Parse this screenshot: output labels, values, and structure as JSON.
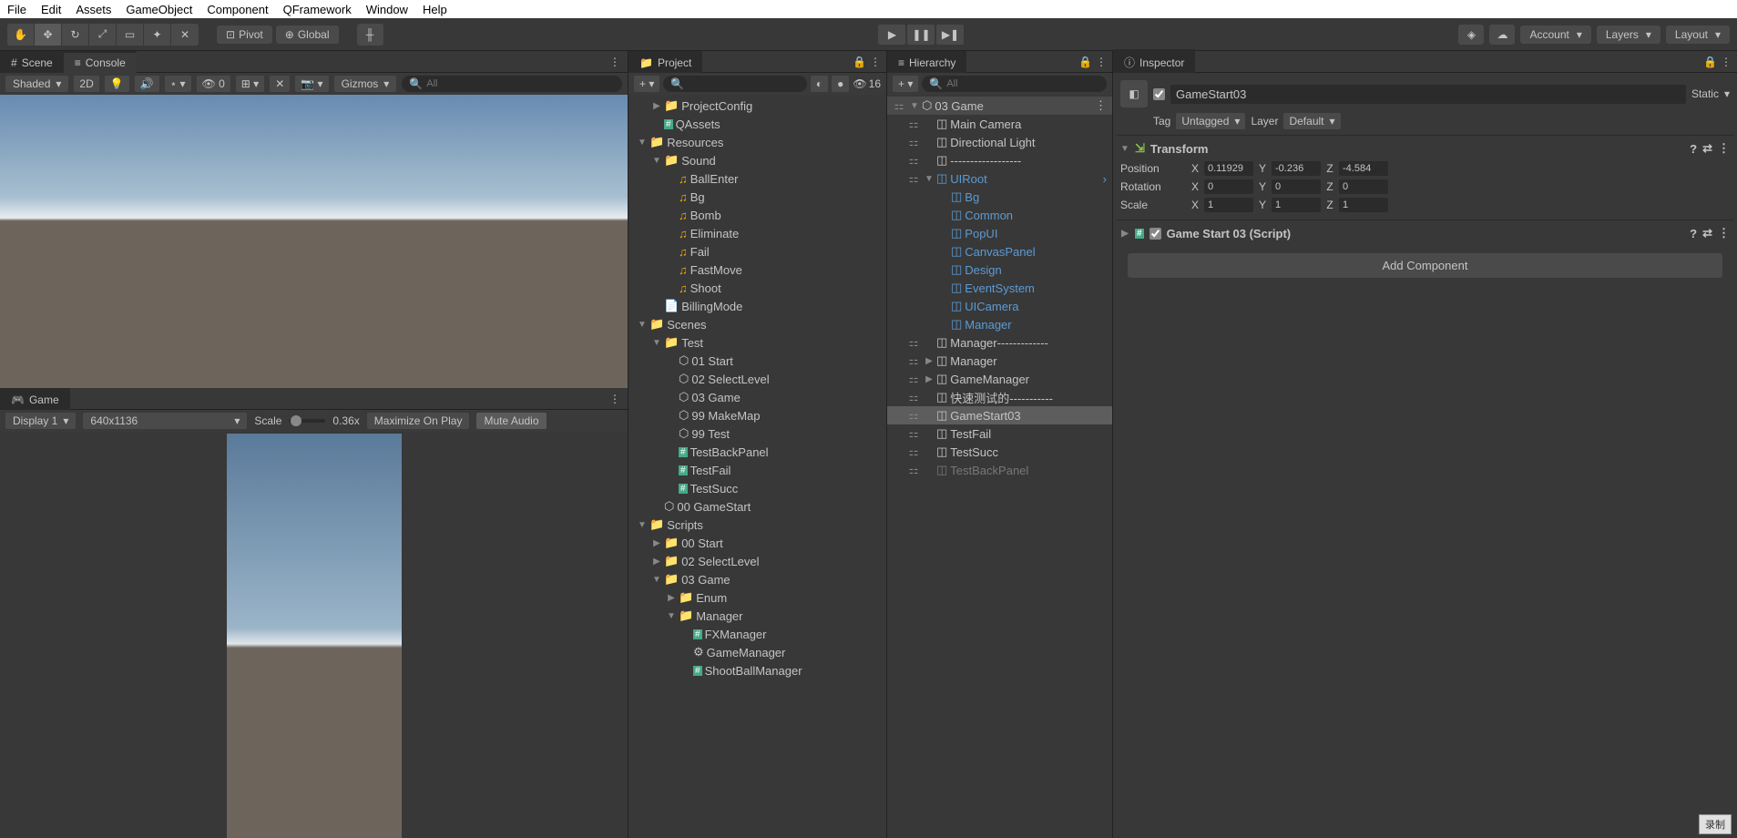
{
  "menubar": [
    "File",
    "Edit",
    "Assets",
    "GameObject",
    "Component",
    "QFramework",
    "Window",
    "Help"
  ],
  "toolbar": {
    "pivot": "Pivot",
    "global": "Global",
    "account": "Account",
    "layers": "Layers",
    "layout": "Layout"
  },
  "scene": {
    "tab": "Scene",
    "console_tab": "Console",
    "shading": "Shaded",
    "mode2d": "2D",
    "visibility_count": "0",
    "gizmos": "Gizmos",
    "search_ph": "All"
  },
  "game": {
    "tab": "Game",
    "display": "Display 1",
    "resolution": "640x1136",
    "scale_label": "Scale",
    "scale_value": "0.36x",
    "maximize": "Maximize On Play",
    "mute": "Mute Audio"
  },
  "project": {
    "tab": "Project",
    "hidden_count": "16",
    "search_ph": "",
    "tree": [
      {
        "d": 1,
        "arr": "▶",
        "icon": "folder",
        "name": "ProjectConfig"
      },
      {
        "d": 1,
        "arr": "",
        "icon": "cs",
        "name": "QAssets"
      },
      {
        "d": 0,
        "arr": "▼",
        "icon": "folder",
        "name": "Resources"
      },
      {
        "d": 1,
        "arr": "▼",
        "icon": "folder",
        "name": "Sound"
      },
      {
        "d": 2,
        "arr": "",
        "icon": "audio",
        "name": "BallEnter"
      },
      {
        "d": 2,
        "arr": "",
        "icon": "audio",
        "name": "Bg"
      },
      {
        "d": 2,
        "arr": "",
        "icon": "audio",
        "name": "Bomb"
      },
      {
        "d": 2,
        "arr": "",
        "icon": "audio",
        "name": "Eliminate"
      },
      {
        "d": 2,
        "arr": "",
        "icon": "audio",
        "name": "Fail"
      },
      {
        "d": 2,
        "arr": "",
        "icon": "audio",
        "name": "FastMove"
      },
      {
        "d": 2,
        "arr": "",
        "icon": "audio",
        "name": "Shoot"
      },
      {
        "d": 1,
        "arr": "",
        "icon": "doc",
        "name": "BillingMode"
      },
      {
        "d": 0,
        "arr": "▼",
        "icon": "folder",
        "name": "Scenes"
      },
      {
        "d": 1,
        "arr": "▼",
        "icon": "folder",
        "name": "Test"
      },
      {
        "d": 2,
        "arr": "",
        "icon": "unity",
        "name": "01 Start"
      },
      {
        "d": 2,
        "arr": "",
        "icon": "unity",
        "name": "02 SelectLevel"
      },
      {
        "d": 2,
        "arr": "",
        "icon": "unity",
        "name": "03 Game"
      },
      {
        "d": 2,
        "arr": "",
        "icon": "unity",
        "name": "99 MakeMap"
      },
      {
        "d": 2,
        "arr": "",
        "icon": "unity",
        "name": "99 Test"
      },
      {
        "d": 2,
        "arr": "",
        "icon": "cs",
        "name": "TestBackPanel"
      },
      {
        "d": 2,
        "arr": "",
        "icon": "cs",
        "name": "TestFail"
      },
      {
        "d": 2,
        "arr": "",
        "icon": "cs",
        "name": "TestSucc"
      },
      {
        "d": 1,
        "arr": "",
        "icon": "unity",
        "name": "00 GameStart"
      },
      {
        "d": 0,
        "arr": "▼",
        "icon": "folder",
        "name": "Scripts"
      },
      {
        "d": 1,
        "arr": "▶",
        "icon": "folder",
        "name": "00 Start"
      },
      {
        "d": 1,
        "arr": "▶",
        "icon": "folder",
        "name": "02 SelectLevel"
      },
      {
        "d": 1,
        "arr": "▼",
        "icon": "folder",
        "name": "03 Game"
      },
      {
        "d": 2,
        "arr": "▶",
        "icon": "folder",
        "name": "Enum"
      },
      {
        "d": 2,
        "arr": "▼",
        "icon": "folder",
        "name": "Manager"
      },
      {
        "d": 3,
        "arr": "",
        "icon": "cs",
        "name": "FXManager"
      },
      {
        "d": 3,
        "arr": "",
        "icon": "gear",
        "name": "GameManager"
      },
      {
        "d": 3,
        "arr": "",
        "icon": "cs",
        "name": "ShootBallManager"
      }
    ]
  },
  "hierarchy": {
    "tab": "Hierarchy",
    "search_ph": "All",
    "scene": "03 Game",
    "tree": [
      {
        "d": 1,
        "arr": "",
        "icon": "go",
        "name": "Main Camera",
        "hl": false
      },
      {
        "d": 1,
        "arr": "",
        "icon": "go",
        "name": "Directional Light",
        "hl": false
      },
      {
        "d": 1,
        "arr": "",
        "icon": "go",
        "name": "------------------",
        "hl": false
      },
      {
        "d": 1,
        "arr": "▼",
        "icon": "prefab",
        "name": "UIRoot",
        "hl": true,
        "vis": true
      },
      {
        "d": 2,
        "arr": "",
        "icon": "go",
        "name": "Bg",
        "hl": true
      },
      {
        "d": 2,
        "arr": "",
        "icon": "go",
        "name": "Common",
        "hl": true
      },
      {
        "d": 2,
        "arr": "",
        "icon": "go",
        "name": "PopUI",
        "hl": true
      },
      {
        "d": 2,
        "arr": "",
        "icon": "go",
        "name": "CanvasPanel",
        "hl": true
      },
      {
        "d": 2,
        "arr": "",
        "icon": "go",
        "name": "Design",
        "hl": true
      },
      {
        "d": 2,
        "arr": "",
        "icon": "go",
        "name": "EventSystem",
        "hl": true
      },
      {
        "d": 2,
        "arr": "",
        "icon": "go",
        "name": "UICamera",
        "hl": true
      },
      {
        "d": 2,
        "arr": "",
        "icon": "go",
        "name": "Manager",
        "hl": true
      },
      {
        "d": 1,
        "arr": "",
        "icon": "go",
        "name": "Manager-------------",
        "hl": false
      },
      {
        "d": 1,
        "arr": "▶",
        "icon": "go",
        "name": "Manager",
        "hl": false
      },
      {
        "d": 1,
        "arr": "▶",
        "icon": "go",
        "name": "GameManager",
        "hl": false
      },
      {
        "d": 1,
        "arr": "",
        "icon": "go",
        "name": "快速测试的-----------",
        "hl": false
      },
      {
        "d": 1,
        "arr": "",
        "icon": "go",
        "name": "GameStart03",
        "hl": false,
        "sel": true
      },
      {
        "d": 1,
        "arr": "",
        "icon": "go",
        "name": "TestFail",
        "hl": false
      },
      {
        "d": 1,
        "arr": "",
        "icon": "go",
        "name": "TestSucc",
        "hl": false
      },
      {
        "d": 1,
        "arr": "",
        "icon": "go",
        "name": "TestBackPanel",
        "hl": false,
        "dim": true
      }
    ]
  },
  "inspector": {
    "tab": "Inspector",
    "name": "GameStart03",
    "static": "Static",
    "tag_label": "Tag",
    "tag_value": "Untagged",
    "layer_label": "Layer",
    "layer_value": "Default",
    "transform": {
      "title": "Transform",
      "position": {
        "label": "Position",
        "x": "0.11929",
        "y": "-0.236",
        "z": "-4.584"
      },
      "rotation": {
        "label": "Rotation",
        "x": "0",
        "y": "0",
        "z": "0"
      },
      "scale": {
        "label": "Scale",
        "x": "1",
        "y": "1",
        "z": "1"
      }
    },
    "script": {
      "title": "Game Start 03 (Script)"
    },
    "add_component": "Add Component"
  },
  "record": "录制"
}
